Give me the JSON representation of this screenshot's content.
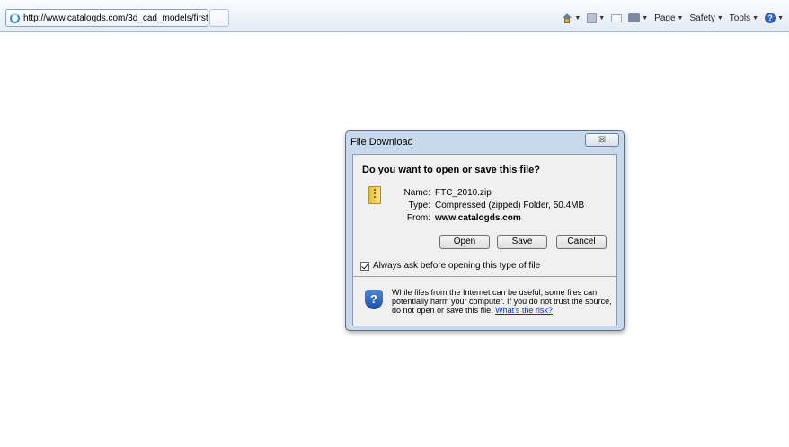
{
  "browser": {
    "tab_title": "http://www.catalogds.com/3d_cad_models/first/...",
    "command_bar": {
      "page_label": "Page",
      "safety_label": "Safety",
      "tools_label": "Tools"
    }
  },
  "dialog": {
    "title": "File Download",
    "close_glyph": "☒",
    "question": "Do you want to open or save this file?",
    "file": {
      "name_label": "Name:",
      "name_value": "FTC_2010.zip",
      "type_label": "Type:",
      "type_value": "Compressed (zipped) Folder, 50.4MB",
      "from_label": "From:",
      "from_value": "www.catalogds.com"
    },
    "buttons": {
      "open": "Open",
      "save": "Save",
      "cancel": "Cancel"
    },
    "always_ask_label": "Always ask before opening this type of file",
    "always_ask_checked": true,
    "warning_text": "While files from the Internet can be useful, some files can potentially harm your computer. If you do not trust the source, do not open or save this file.",
    "warning_link": "What's the risk?"
  },
  "icons": {
    "help": "?",
    "shield": "?"
  }
}
